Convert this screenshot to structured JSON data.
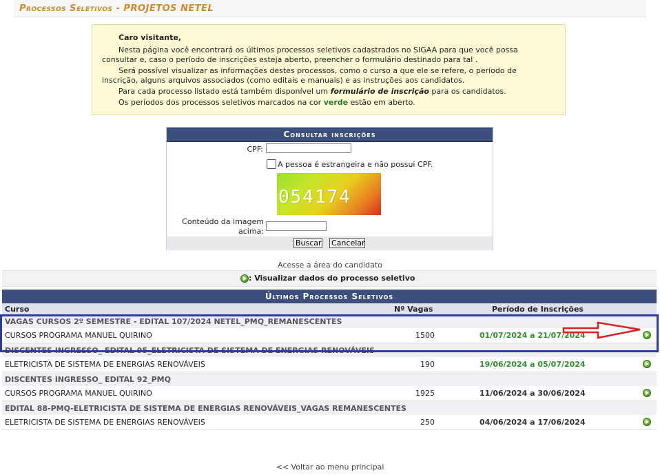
{
  "header": {
    "title": "Processos Seletivos - PROJETOS NETEL"
  },
  "notice": {
    "greeting": "Caro visitante,",
    "p1": "Nesta página você encontrará os últimos processos seletivos cadastrados no SIGAA para que você possa",
    "p1b": "consultar e, caso o período de inscrições esteja aberto, preencher o formulário destinado para tal .",
    "p2": "Será possível visualizar as informações destes processos, como o curso a que ele se refere, o período de",
    "p2b": "inscrição, alguns arquivos associados (como editais e manuais) e as instruções aos candidatos.",
    "p3_pre": "Para cada processo listado está também disponível um ",
    "p3_em": "formulário de inscrição",
    "p3_post": " para os candidatos.",
    "p4_pre": "Os períodos dos processos seletivos marcados na cor ",
    "p4_em": "verde",
    "p4_post": " estão em aberto."
  },
  "form": {
    "caption": "Consultar inscrições",
    "cpf_label": "CPF:",
    "cpf_value": "",
    "foreign_label": "A pessoa é estrangeira e não possui CPF.",
    "captcha_text": "054174",
    "captcha_label_1": "Conteúdo da imagem",
    "captcha_label_2": "acima:",
    "captcha_value": "",
    "search_button": "Buscar",
    "cancel_button": "Cancelar"
  },
  "candidate_area_link": "Acesse a área do candidato",
  "legend": {
    "label": ": Visualizar dados do processo seletivo",
    "icon": "view-process-icon"
  },
  "table": {
    "caption": "Últimos Processos Seletivos",
    "headers": {
      "curso": "Curso",
      "vagas": "Nº Vagas",
      "periodo": "Período de Inscrições"
    },
    "groups": [
      {
        "title": "VAGAS CURSOS 2º SEMESTRE - EDITAL 107/2024 NETEL_PMQ_REMANESCENTES",
        "course": "CURSOS PROGRAMA MANUEL QUIRINO",
        "vagas": "1500",
        "period": "01/07/2024 a 21/07/2024",
        "status": "open"
      },
      {
        "title": "DISCENTES INGRESSO_ EDITAL 95_ELETRICISTA DE SISTEMA DE ENERGIAS RENOVÁVEIS",
        "course": "ELETRICISTA DE SISTEMA DE ENERGIAS RENOVÁVEIS",
        "vagas": "190",
        "period": "19/06/2024 a 05/07/2024",
        "status": "open"
      },
      {
        "title": "DISCENTES INGRESSO_ EDITAL 92_PMQ",
        "course": "CURSOS PROGRAMA MANUEL QUIRINO",
        "vagas": "1925",
        "period": "11/06/2024 a 30/06/2024",
        "status": "closed"
      },
      {
        "title": "EDITAL 88-PMQ-ELETRICISTA DE SISTEMA DE ENERGIAS RENOVÁVEIS_VAGAS REMANESCENTES",
        "course": "ELETRICISTA DE SISTEMA DE ENERGIAS RENOVÁVEIS",
        "vagas": "250",
        "period": "04/06/2024 a 17/06/2024",
        "status": "closed"
      }
    ]
  },
  "back_link": "<< Voltar ao menu principal",
  "colors": {
    "open": "#2f8f2f",
    "header_bar": "#3c4f7c",
    "highlight_box": "#2d3aa6",
    "arrow": "#e02020"
  }
}
